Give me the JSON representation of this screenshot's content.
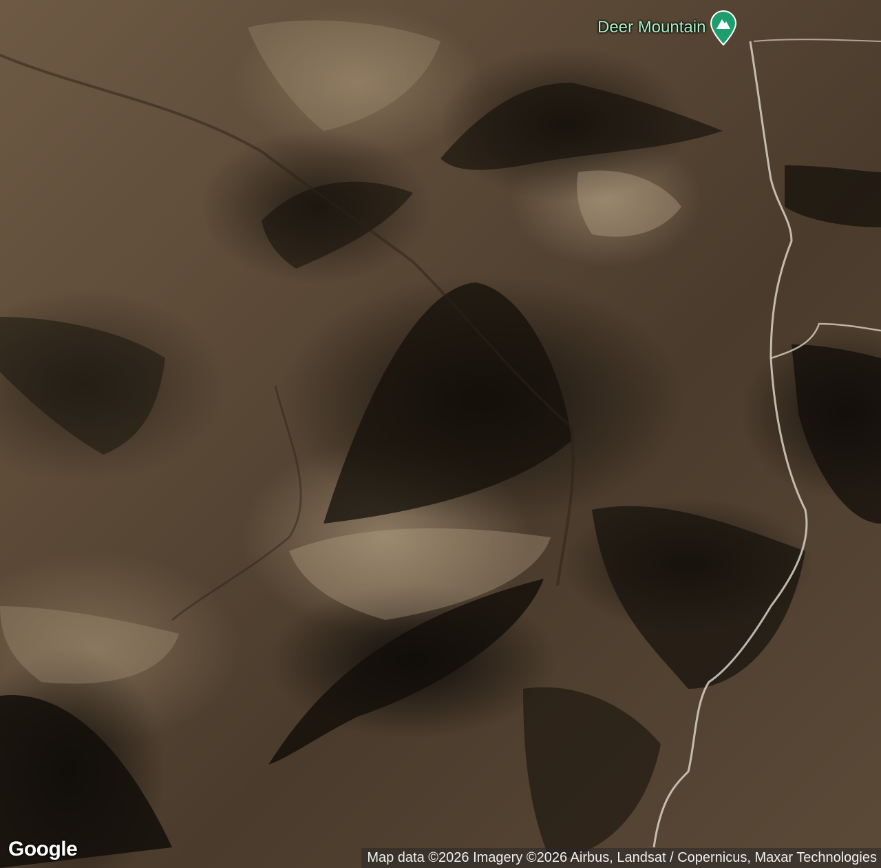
{
  "map": {
    "view": "satellite"
  },
  "poi": {
    "label": "Deer Mountain",
    "icon": "mountain-icon",
    "pin_color": "#1e9e6e",
    "label_color": "#a8f0c8"
  },
  "branding": {
    "logo_text": "Google"
  },
  "attribution": {
    "text": "Map data ©2026 Imagery ©2026 Airbus, Landsat / Copernicus, Maxar Technologies"
  },
  "colors": {
    "road": "#d8d2c6",
    "forest": "#14100a"
  }
}
